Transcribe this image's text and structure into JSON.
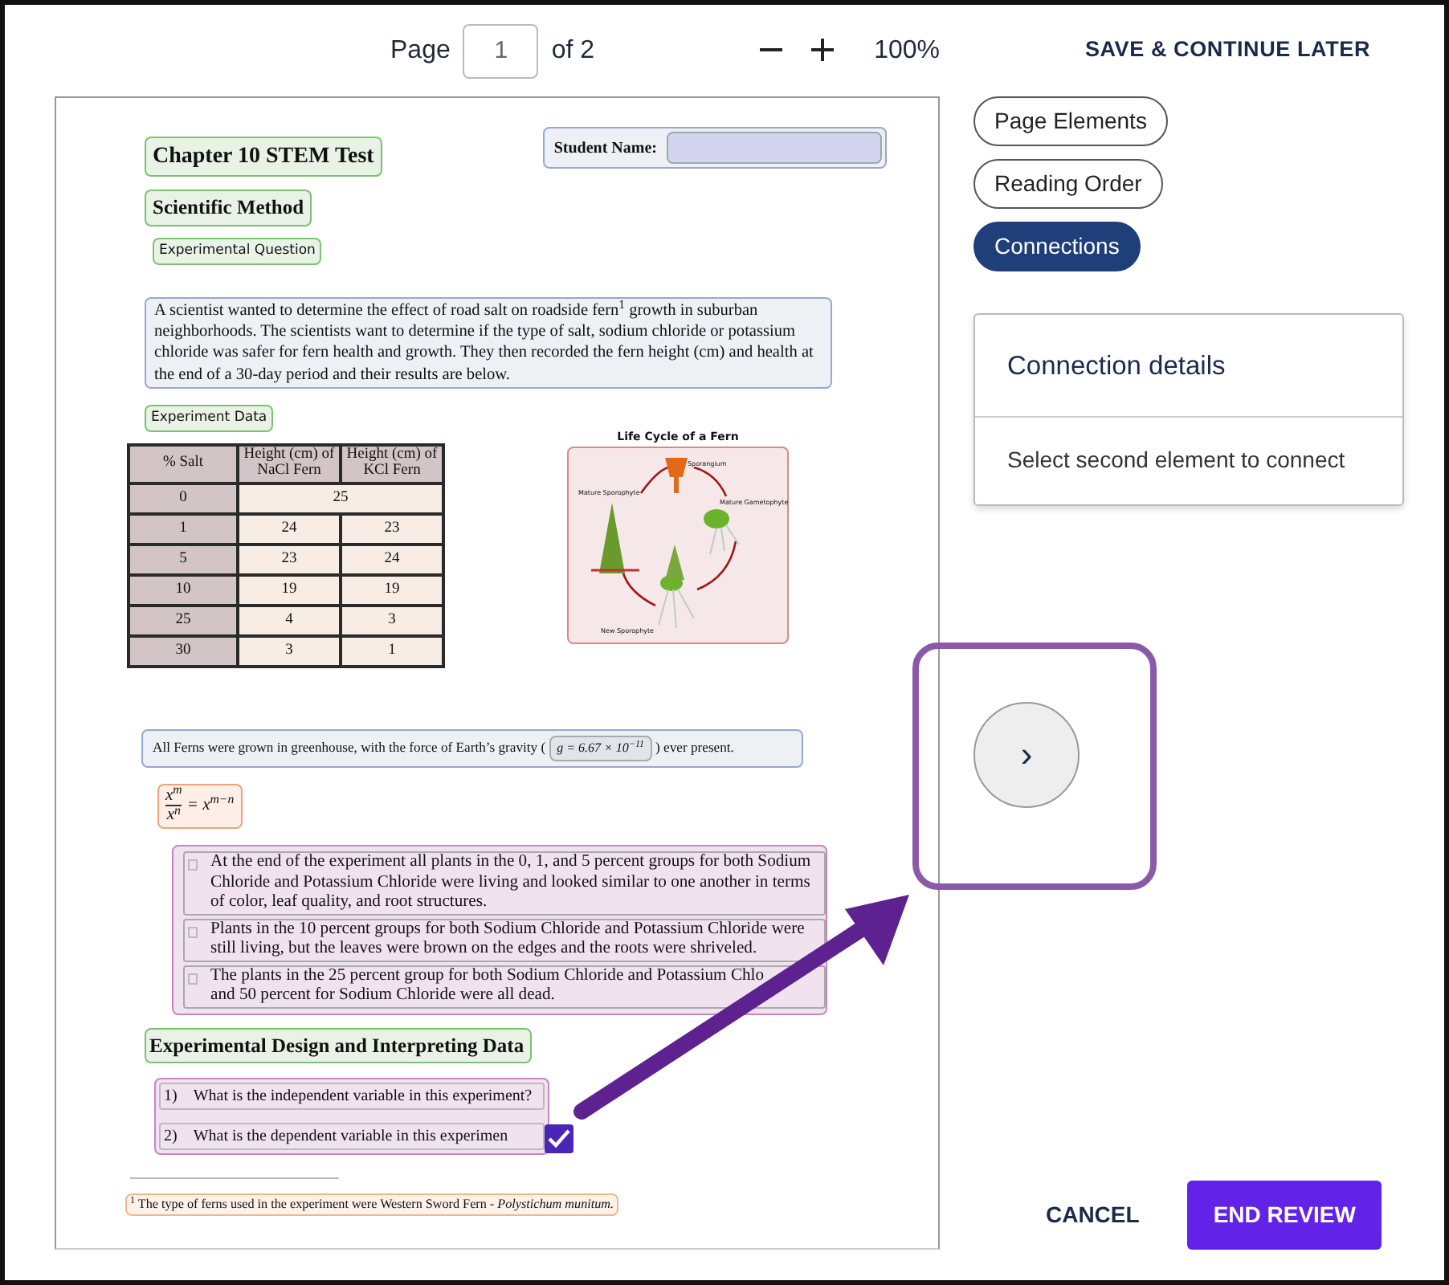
{
  "toolbar": {
    "page_label": "Page",
    "page_value": "1",
    "page_total": "of 2",
    "zoom": "100%",
    "save": "SAVE & CONTINUE LATER"
  },
  "document": {
    "title": "Chapter 10 STEM Test",
    "student_label": "Student Name:",
    "heading": "Scientific Method",
    "question_label": "Experimental Question",
    "paragraph": "A scientist wanted to determine the effect of road salt on roadside fern$^{1}$ growth in suburban neighborhoods. The scientists want to determine if the type of salt, sodium chloride or potassium chloride was safer for fern health and growth. They then recorded the fern height (cm) and health at the end of a 30-day period and their results are below.",
    "data_label": "Experiment Data",
    "table": {
      "columns": [
        "% Salt",
        "Height (cm) of NaCl Fern",
        "Height (cm) of KCl Fern"
      ],
      "rows": [
        [
          "0",
          {
            "text": "25",
            "colspan": 2
          }
        ],
        [
          "1",
          "24",
          "23"
        ],
        [
          "5",
          "23",
          "24"
        ],
        [
          "10",
          "19",
          "19"
        ],
        [
          "25",
          "4",
          "3"
        ],
        [
          "30",
          "3",
          "1"
        ]
      ]
    },
    "figure": {
      "title": "Life Cycle of a Fern",
      "labels": [
        "Sporangium",
        "Mature Sporophyte",
        "Mature Gametophyte",
        "New Sporophyte"
      ]
    },
    "gravity": {
      "before": "All Ferns were grown in greenhouse, with the  force of Earth’s gravity (",
      "formula": "g = 6.67 × 10$^{−11}$",
      "after": ") ever present."
    },
    "equation": {
      "numerator": "x$^{m}$",
      "denominator": "x$^{n}$",
      "rhs": "= x$^{m−n}$"
    },
    "observations": [
      {
        "lines": [
          "At the end of the experiment all plants in the 0, 1, and 5 percent groups for both Sodium",
          "Chloride and Potassium Chloride were living and looked similar to one another in terms",
          "of color,  leaf quality, and root structures."
        ],
        "checked": false
      },
      {
        "lines": [
          "Plants in the 10 percent groups for both Sodium Chloride and Potassium Chloride were",
          "still living, but the leaves were brown on the edges and the roots were shriveled."
        ],
        "checked": false
      },
      {
        "lines": [
          "The plants in the 25 percent group for both Sodium Chloride and Potassium Chlo",
          "and 50 percent for Sodium Chloride were all dead."
        ],
        "checked": false
      }
    ],
    "heading2": "Experimental Design and Interpreting Data",
    "questions": [
      {
        "number": "1)",
        "text": "What is the independent variable in this experiment?",
        "checked": false
      },
      {
        "number": "2)",
        "text": "What is the dependent variable in this experimen",
        "checked": true
      }
    ],
    "footnote": "$^{1}$ The type of ferns used in the experiment were Western Sword Fern - *Polystichum munitum.*"
  },
  "tabs": [
    {
      "label": "Page Elements",
      "selected": false
    },
    {
      "label": "Reading Order",
      "selected": false
    },
    {
      "label": "Connections",
      "selected": true
    }
  ],
  "details": {
    "title": "Connection details",
    "message": "Select second element to connect"
  },
  "next_button": "›",
  "footer": {
    "cancel": "CANCEL",
    "end": "END REVIEW"
  }
}
